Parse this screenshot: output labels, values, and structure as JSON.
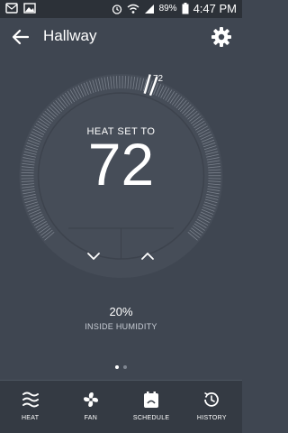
{
  "status_bar": {
    "battery": "89%",
    "time": "4:47 PM"
  },
  "app_bar": {
    "title": "Hallway"
  },
  "thermostat": {
    "mode_label": "HEAT SET TO",
    "setpoint": "72",
    "current_marker_label": "72"
  },
  "humidity": {
    "value": "20%",
    "label": "INSIDE HUMIDITY"
  },
  "pager": {
    "pages": 2,
    "active": 0
  },
  "nav": {
    "heat": "HEAT",
    "fan": "FAN",
    "schedule": "SCHEDULE",
    "history": "HISTORY"
  },
  "colors": {
    "background": "#3f4651",
    "dial_inner": "#464d58",
    "text": "#ffffff"
  }
}
